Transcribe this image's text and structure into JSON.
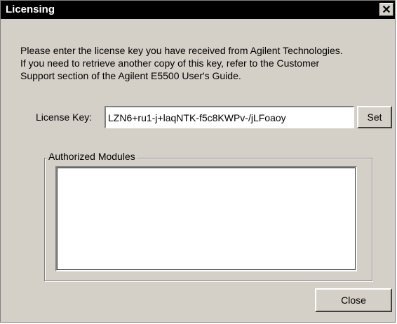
{
  "window": {
    "title": "Licensing",
    "close_glyph": "✕"
  },
  "instructions": "Please enter the license key you have received from Agilent Technologies.\nIf you need to retrieve another copy of this key, refer to the Customer\nSupport section of the Agilent E5500 User's Guide.",
  "license_key": {
    "label": "License Key:",
    "value": "LZN6+ru1-j+laqNTK-f5c8KWPv-/jLFoaoy",
    "set_label": "Set"
  },
  "authorized_modules": {
    "legend": "Authorized Modules",
    "items": []
  },
  "footer": {
    "close_label": "Close"
  },
  "colors": {
    "titlebar": "#000000",
    "dialog": "#d4d0c8"
  }
}
